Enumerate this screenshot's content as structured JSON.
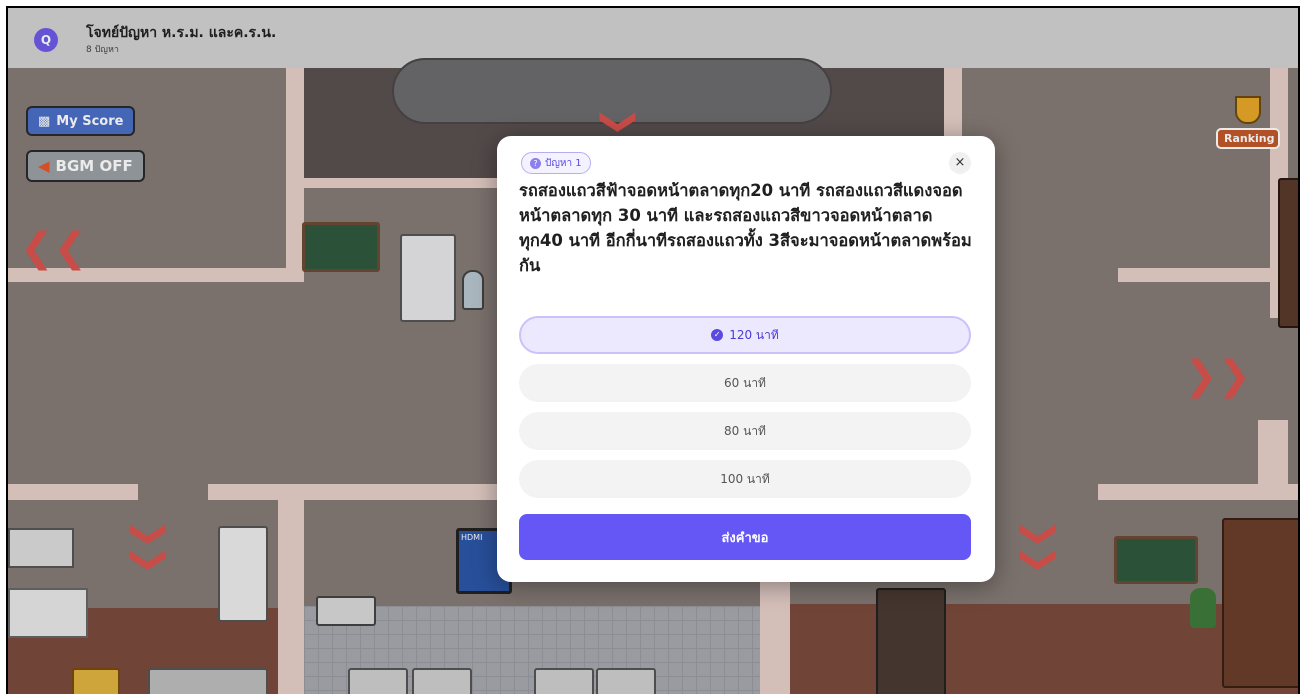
{
  "header": {
    "icon_glyph": "Q",
    "title": "โจทย์ปัญหา ห.ร.ม. และค.ร.น.",
    "subtitle": "8 ปัญหา"
  },
  "hud": {
    "score_label": "My Score",
    "bgm_label": "BGM OFF",
    "ranking_label": "Ranking"
  },
  "quiz": {
    "badge_icon": "?",
    "badge_label": "ปัญหา 1",
    "close_glyph": "×",
    "question": "รถสองแถวสีฟ้าจอดหน้าตลาดทุก20 นาที  รถสองแถวสีแดงจอดหน้าตลาดทุก 30 นาที และรถสองแถวสีขาวจอดหน้าตลาดทุก40 นาที  อีกกี่นาทีรถสองแถวทั้ง 3สีจะมาจอดหน้าตลาดพร้อมกัน",
    "options": [
      {
        "label": "120 นาที",
        "selected": true
      },
      {
        "label": "60 นาที",
        "selected": false
      },
      {
        "label": "80 นาที",
        "selected": false
      },
      {
        "label": "100 นาที",
        "selected": false
      }
    ],
    "check_glyph": "✓",
    "submit_label": "ส่งคำขอ"
  },
  "map": {
    "arrow_left": "❮❮",
    "arrow_right": "❯❯",
    "arrow_down": "❯",
    "hdmi_label": "HDMI"
  },
  "colors": {
    "accent": "#6557f5",
    "map_floor": "#857a76",
    "arrow_red": "#d9534f"
  }
}
